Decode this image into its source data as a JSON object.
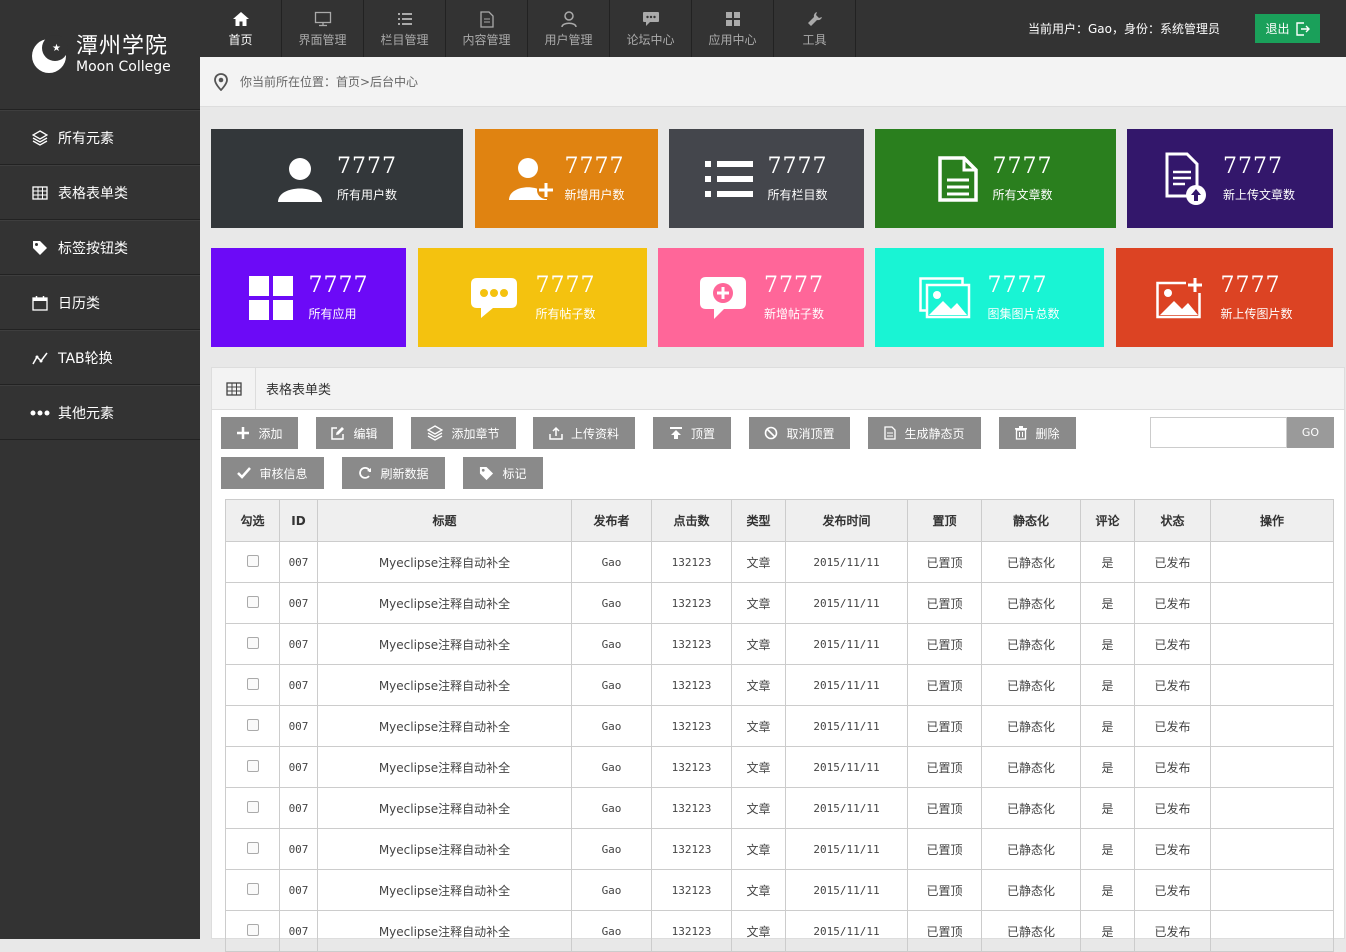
{
  "logo": {
    "cn": "潭州学院",
    "en": "Moon College"
  },
  "sidebar": {
    "items": [
      {
        "label": "所有元素",
        "icon": "layers-icon"
      },
      {
        "label": "表格表单类",
        "icon": "table-icon"
      },
      {
        "label": "标签按钮类",
        "icon": "tag-icon"
      },
      {
        "label": "日历类",
        "icon": "calendar-icon"
      },
      {
        "label": "TAB轮换",
        "icon": "chart-line-icon"
      },
      {
        "label": "其他元素",
        "icon": "more-dots-icon"
      }
    ]
  },
  "topbar": {
    "tabs": [
      {
        "label": "首页",
        "icon": "home-icon",
        "active": true
      },
      {
        "label": "界面管理",
        "icon": "monitor-icon"
      },
      {
        "label": "栏目管理",
        "icon": "list-icon"
      },
      {
        "label": "内容管理",
        "icon": "document-icon"
      },
      {
        "label": "用户管理",
        "icon": "user-icon"
      },
      {
        "label": "论坛中心",
        "icon": "chat-icon"
      },
      {
        "label": "应用中心",
        "icon": "grid-icon"
      },
      {
        "label": "工具",
        "icon": "wrench-icon"
      }
    ],
    "user_info": "当前用户：Gao，身份：系统管理员",
    "logout_label": "退出"
  },
  "breadcrumb": {
    "text": "你当前所在位置：首页>后台中心"
  },
  "stats": [
    {
      "value": "7777",
      "label": "所有用户数",
      "color": "#33373a",
      "icon": "user-icon"
    },
    {
      "value": "7777",
      "label": "新增用户数",
      "color": "#e08311",
      "icon": "user-add-icon"
    },
    {
      "value": "7777",
      "label": "所有栏目数",
      "color": "#44464c",
      "icon": "list-icon"
    },
    {
      "value": "7777",
      "label": "所有文章数",
      "color": "#2a7f1e",
      "icon": "document-icon"
    },
    {
      "value": "7777",
      "label": "新上传文章数",
      "color": "#33176b",
      "icon": "document-upload-icon"
    },
    {
      "value": "7777",
      "label": "所有应用",
      "color": "#6c0af7",
      "icon": "grid-icon"
    },
    {
      "value": "7777",
      "label": "所有帖子数",
      "color": "#f4c20f",
      "icon": "chat-bubble-icon"
    },
    {
      "value": "7777",
      "label": "新增帖子数",
      "color": "#ff6699",
      "icon": "chat-add-icon"
    },
    {
      "value": "7777",
      "label": "图集图片总数",
      "color": "#19f4d4",
      "icon": "image-gallery-icon"
    },
    {
      "value": "7777",
      "label": "新上传图片数",
      "color": "#dc4323",
      "icon": "image-add-icon"
    }
  ],
  "panel": {
    "title": "表格表单类",
    "buttons": [
      {
        "label": "添加",
        "icon": "plus-icon"
      },
      {
        "label": "编辑",
        "icon": "edit-icon"
      },
      {
        "label": "添加章节",
        "icon": "layers-icon"
      },
      {
        "label": "上传资料",
        "icon": "upload-icon"
      },
      {
        "label": "顶置",
        "icon": "to-top-icon"
      },
      {
        "label": "取消顶置",
        "icon": "ban-icon"
      },
      {
        "label": "生成静态页",
        "icon": "file-icon"
      },
      {
        "label": "删除",
        "icon": "trash-icon"
      },
      {
        "label": "审核信息",
        "icon": "check-icon"
      },
      {
        "label": "刷新数据",
        "icon": "refresh-icon"
      },
      {
        "label": "标记",
        "icon": "tag-icon"
      }
    ],
    "search_value": "",
    "go_label": "GO"
  },
  "table": {
    "headers": [
      "勾选",
      "ID",
      "标题",
      "发布者",
      "点击数",
      "类型",
      "发布时间",
      "置顶",
      "静态化",
      "评论",
      "状态",
      "操作"
    ],
    "rows": [
      [
        "007",
        "Myeclipse注释自动补全",
        "Gao",
        "132123",
        "文章",
        "2015/11/11",
        "已置顶",
        "已静态化",
        "是",
        "已发布",
        ""
      ],
      [
        "007",
        "Myeclipse注释自动补全",
        "Gao",
        "132123",
        "文章",
        "2015/11/11",
        "已置顶",
        "已静态化",
        "是",
        "已发布",
        ""
      ],
      [
        "007",
        "Myeclipse注释自动补全",
        "Gao",
        "132123",
        "文章",
        "2015/11/11",
        "已置顶",
        "已静态化",
        "是",
        "已发布",
        ""
      ],
      [
        "007",
        "Myeclipse注释自动补全",
        "Gao",
        "132123",
        "文章",
        "2015/11/11",
        "已置顶",
        "已静态化",
        "是",
        "已发布",
        ""
      ],
      [
        "007",
        "Myeclipse注释自动补全",
        "Gao",
        "132123",
        "文章",
        "2015/11/11",
        "已置顶",
        "已静态化",
        "是",
        "已发布",
        ""
      ],
      [
        "007",
        "Myeclipse注释自动补全",
        "Gao",
        "132123",
        "文章",
        "2015/11/11",
        "已置顶",
        "已静态化",
        "是",
        "已发布",
        ""
      ],
      [
        "007",
        "Myeclipse注释自动补全",
        "Gao",
        "132123",
        "文章",
        "2015/11/11",
        "已置顶",
        "已静态化",
        "是",
        "已发布",
        ""
      ],
      [
        "007",
        "Myeclipse注释自动补全",
        "Gao",
        "132123",
        "文章",
        "2015/11/11",
        "已置顶",
        "已静态化",
        "是",
        "已发布",
        ""
      ],
      [
        "007",
        "Myeclipse注释自动补全",
        "Gao",
        "132123",
        "文章",
        "2015/11/11",
        "已置顶",
        "已静态化",
        "是",
        "已发布",
        ""
      ],
      [
        "007",
        "Myeclipse注释自动补全",
        "Gao",
        "132123",
        "文章",
        "2015/11/11",
        "已置顶",
        "已静态化",
        "是",
        "已发布",
        ""
      ]
    ]
  }
}
